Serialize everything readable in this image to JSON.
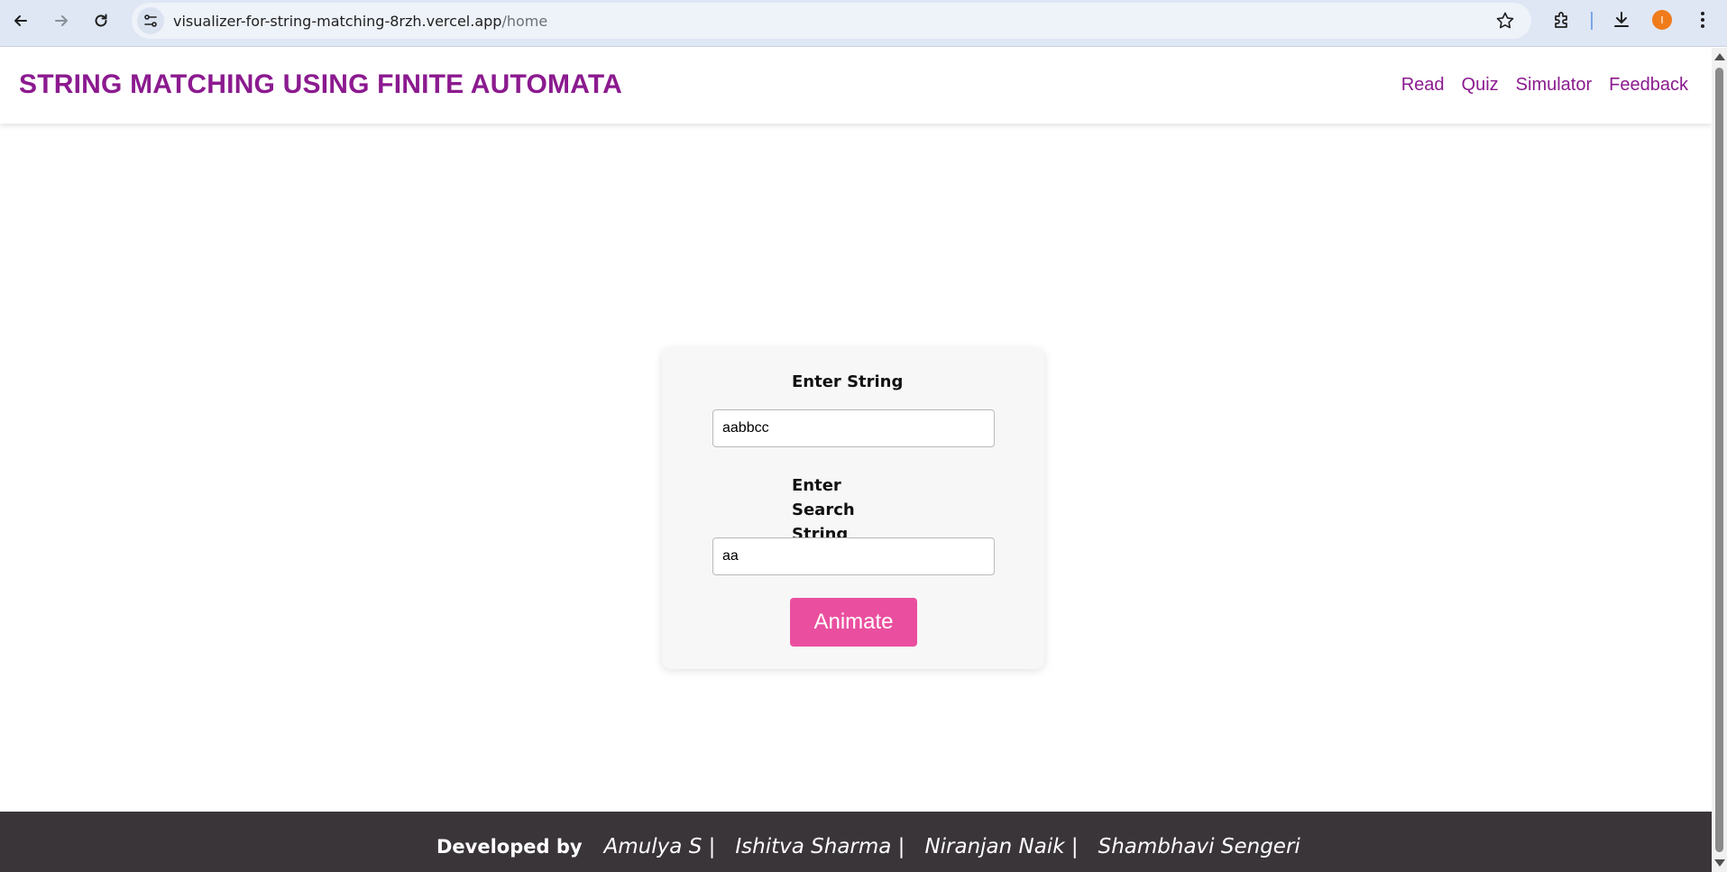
{
  "browser": {
    "url_host": "visualizer-for-string-matching-8rzh.vercel.app",
    "url_path": "/home",
    "profile_initial": "I"
  },
  "header": {
    "title": "STRING MATCHING USING FINITE AUTOMATA",
    "nav": [
      "Read",
      "Quiz",
      "Simulator",
      "Feedback"
    ]
  },
  "form": {
    "string_label": "Enter String",
    "string_value": "aabbcc",
    "search_label": "Enter Search String",
    "search_value": "aa",
    "animate_label": "Animate"
  },
  "footer": {
    "developed_by": "Developed by",
    "names": [
      "Amulya S |",
      "Ishitva Sharma |",
      "Niranjan Naik |",
      "Shambhavi Sengeri"
    ]
  },
  "colors": {
    "brand_purple": "#8b1a8f",
    "button_pink": "#ea4f9f",
    "footer_bg": "#3a3539"
  }
}
